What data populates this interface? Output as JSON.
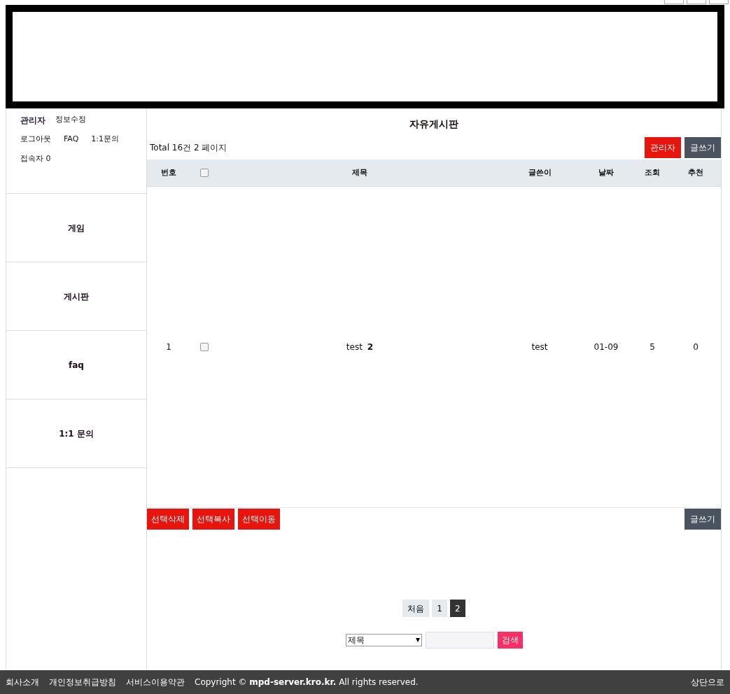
{
  "user_panel": {
    "user_name": "관리자",
    "links": [
      "정보수정",
      "로그아웃",
      "FAQ",
      "1:1문의"
    ],
    "visitors": "접속자 0"
  },
  "menu": [
    {
      "label": "게임"
    },
    {
      "label": "게시판"
    },
    {
      "label": "faq"
    },
    {
      "label": "1:1 문의"
    }
  ],
  "board": {
    "title": "자유게시판",
    "total": "Total 16건 2 페이지",
    "admin_button": "관리자",
    "write_button": "글쓰기",
    "columns": [
      "번호",
      "",
      "제목",
      "글쓴이",
      "날짜",
      "조회",
      "추천"
    ],
    "select_all": {
      "checked": false
    },
    "rows": [
      {
        "number": "1",
        "checked": false,
        "subject": "test",
        "comment_count": "2",
        "writer": "test",
        "date": "01-09",
        "views": "5",
        "likes": "0"
      }
    ],
    "actions": [
      "선택삭제",
      "선택복사",
      "선택이동"
    ],
    "write_button_bottom": "글쓰기",
    "pagination": [
      {
        "label": "처음",
        "selected": false
      },
      {
        "label": "1",
        "selected": false
      },
      {
        "label": "2",
        "selected": true
      }
    ],
    "search": {
      "field": "제목",
      "button": "검색"
    }
  },
  "footer": {
    "links": [
      "회사소개",
      "개인정보취급방침",
      "서비스이용약관"
    ],
    "copyright": "Copyright © **mpd-server.kro.kr.** All rights reserved.",
    "top_link": "상단으로"
  }
}
